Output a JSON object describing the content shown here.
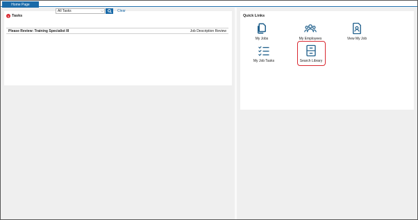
{
  "tabs": [
    {
      "label": "Home Page"
    }
  ],
  "tasks": {
    "title": "Tasks",
    "badge_count": "1",
    "filter_selected": "All Tasks",
    "clear_label": "Clear",
    "rows": [
      {
        "name": "Please Review: Training Specialist III",
        "type": "Job Description Review"
      }
    ]
  },
  "quick_links": {
    "title": "Quick Links",
    "items": [
      {
        "label": "My Jobs",
        "icon": "copy-documents-icon"
      },
      {
        "label": "My Employees",
        "icon": "people-group-icon"
      },
      {
        "label": "View My Job",
        "icon": "user-document-icon"
      },
      {
        "label": "My Job Tasks",
        "icon": "checklist-icon"
      },
      {
        "label": "Search Library",
        "icon": "file-cabinet-icon"
      }
    ]
  },
  "colors": {
    "accent": "#1a6aa8",
    "badge": "#d8262e",
    "highlight": "#d8262e",
    "icon": "#1f5f8b"
  }
}
